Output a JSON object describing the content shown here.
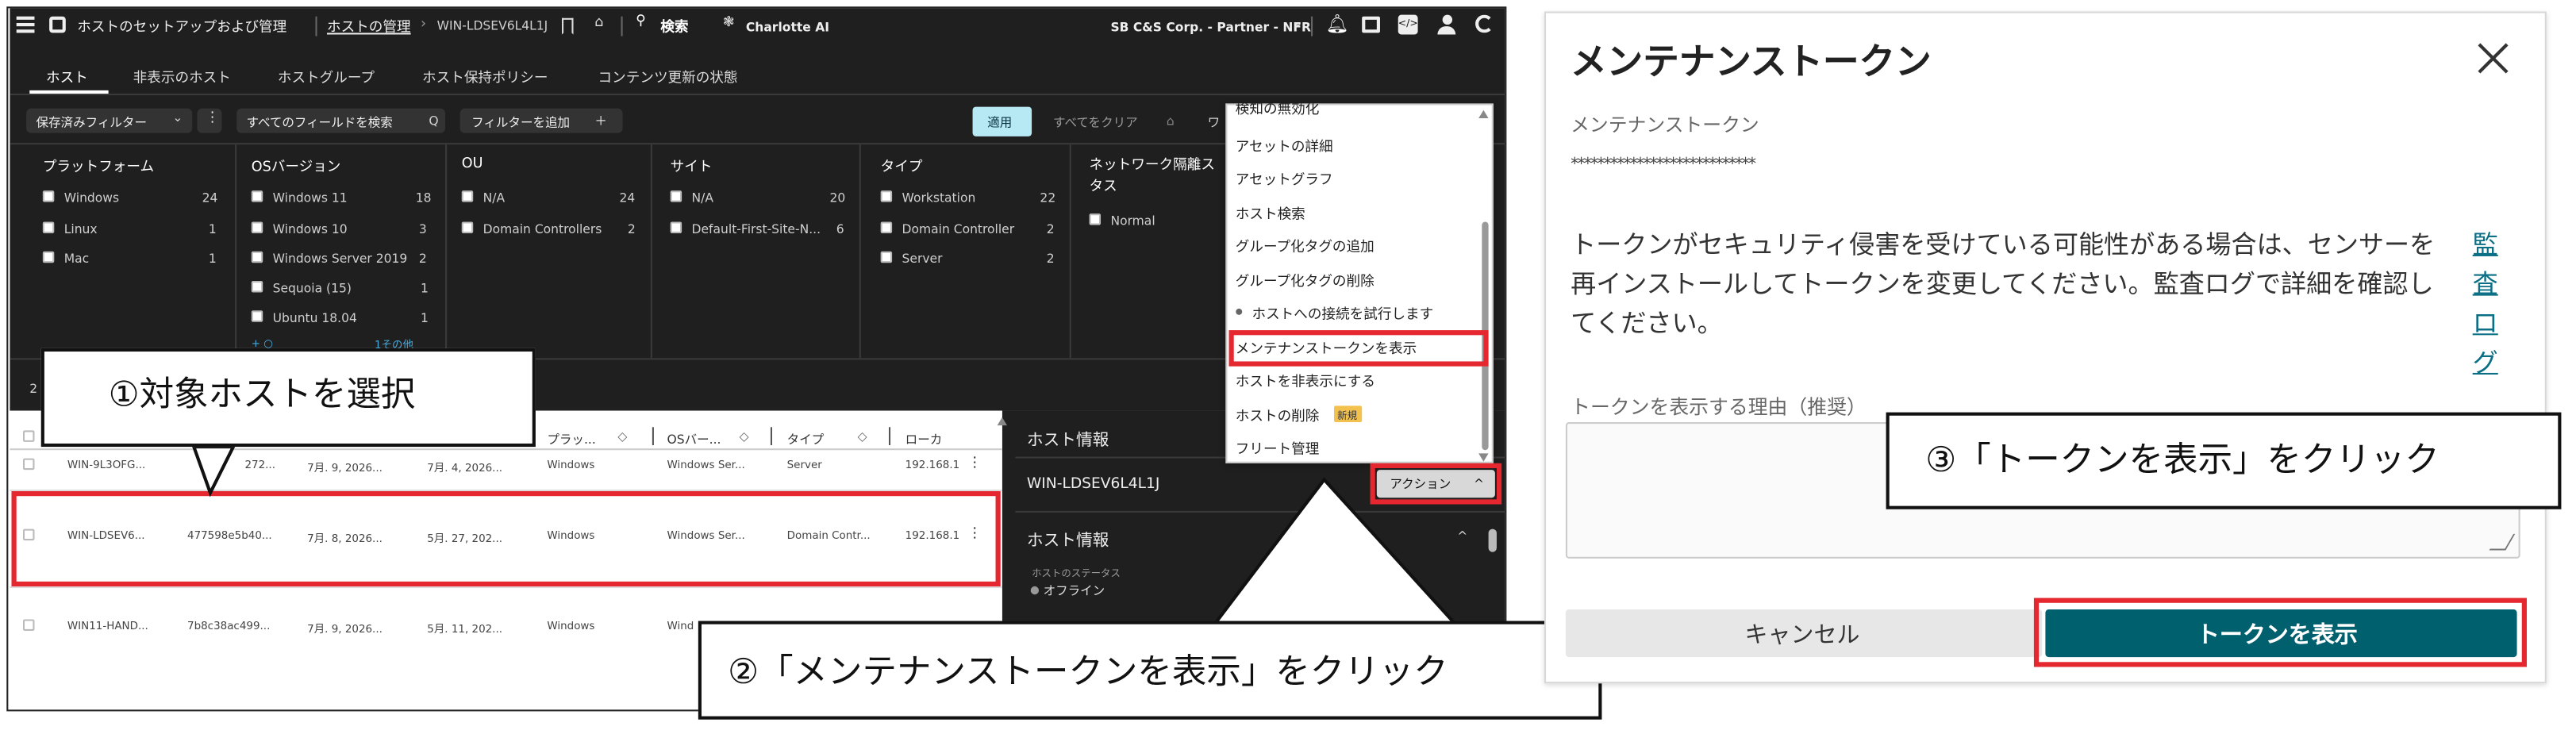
{
  "topbar": {
    "title": "ホストのセットアップおよび管理",
    "breadcrumb_link": "ホストの管理",
    "breadcrumb_sep": "›",
    "host": "WIN-LDSEV6L4L1J",
    "search": "検索",
    "charlotte": "Charlotte AI",
    "company": "SB C&S Corp. - Partner - NFR",
    "company_caret": "⌄"
  },
  "tabs": [
    "ホスト",
    "非表示のホスト",
    "ホストグループ",
    "ホスト保持ポリシー",
    "コンテンツ更新の状態"
  ],
  "filterbar": {
    "saved": "保存済みフィルター",
    "saved_caret": "⌄",
    "more": "⋮",
    "search_fields": "すべてのフィールドを検索",
    "search_icon": "Q",
    "add_filter": "フィルターを追加",
    "plus": "＋",
    "apply": "適用",
    "clear_all": "すべてをクリア",
    "trailing": "ワ"
  },
  "facets": [
    {
      "title": "プラットフォーム",
      "items": [
        {
          "label": "Windows",
          "count": "24"
        },
        {
          "label": "Linux",
          "count": "1"
        },
        {
          "label": "Mac",
          "count": "1"
        }
      ]
    },
    {
      "title": "OSバージョン",
      "items": [
        {
          "label": "Windows 11",
          "count": "18"
        },
        {
          "label": "Windows 10",
          "count": "3"
        },
        {
          "label": "Windows Server 2019",
          "count": "2"
        },
        {
          "label": "Sequoia (15)",
          "count": "1"
        },
        {
          "label": "Ubuntu 18.04",
          "count": "1"
        }
      ],
      "more": "1その他",
      "more_prefix": "+ ○"
    },
    {
      "title": "OU",
      "items": [
        {
          "label": "N/A",
          "count": "24"
        },
        {
          "label": "Domain Controllers",
          "count": "2"
        }
      ]
    },
    {
      "title": "サイト",
      "items": [
        {
          "label": "N/A",
          "count": "20"
        },
        {
          "label": "Default-First-Site-N...",
          "count": "6"
        }
      ]
    },
    {
      "title": "タイプ",
      "items": [
        {
          "label": "Workstation",
          "count": "22"
        },
        {
          "label": "Domain Controller",
          "count": "2"
        },
        {
          "label": "Server",
          "count": "2"
        }
      ]
    },
    {
      "title": "ネットワーク隔離ス タス",
      "items": [
        {
          "label": "Normal",
          "count": ""
        }
      ]
    }
  ],
  "results_count": "2",
  "table": {
    "headers": [
      "プラッ...",
      "OSバー...",
      "タイプ",
      "ローカ"
    ],
    "rows": [
      {
        "name": "WIN-9L3OFG...",
        "id": "272...",
        "first": "7月. 9, 2026...",
        "last": "7月. 4, 2026...",
        "platform": "Windows",
        "os": "Windows Ser...",
        "type": "Server",
        "ip": "192.168.1"
      },
      {
        "name": "WIN-LDSEV6...",
        "id": "477598e5b40...",
        "first": "7月. 8, 2026...",
        "last": "5月. 27, 202...",
        "platform": "Windows",
        "os": "Windows Ser...",
        "type": "Domain Contr...",
        "ip": "192.168.1"
      },
      {
        "name": "WIN11-HAND...",
        "id": "7b8c38ac499...",
        "first": "7月. 9, 2026...",
        "last": "5月. 11, 202...",
        "platform": "Windows",
        "os": "Wind",
        "type": "",
        "ip": ""
      }
    ],
    "kebab": "⋮"
  },
  "panel": {
    "header": "ホスト情報",
    "host": "WIN-LDSEV6L4L1J",
    "action": "アクション",
    "action_caret": "^",
    "section": "ホスト情報",
    "section_caret": "^",
    "status_label": "ホストのステータス",
    "status_dot": "●",
    "status": "オフライン"
  },
  "menu": {
    "items": [
      "検知の無効化",
      "アセットの詳細",
      "アセットグラフ",
      "ホスト検索",
      "グループ化タグの追加",
      "グループ化タグの削除",
      "ホストへの接続を試行します",
      "メンテナンストークンを表示",
      "ホストを非表示にする",
      "ホストの削除",
      "フリート管理"
    ],
    "new_badge": "新規",
    "bullet": "●"
  },
  "callouts": {
    "c1": "①対象ホストを選択",
    "c2": "②「メンテナンストークンを表示」をクリック",
    "c3": "③「トークンを表示」をクリック"
  },
  "dialog": {
    "title": "メンテナンストークン",
    "label": "メンテナンストークン",
    "masked": "****************************",
    "message": "トークンがセキュリティ侵害を受けている可能性がある場合は、センサーを再インストールしてトークンを変更してください。監査ログで詳細を確認してください。",
    "link": "監査ログ",
    "reason_label": "トークンを表示する理由（推奨）",
    "cancel": "キャンセル",
    "show": "トークンを表示"
  },
  "colors": {
    "primary": "#00606e",
    "highlight": "#e5272f",
    "dark_bg": "#1f1f1f",
    "apply_bg": "#b7e9f5",
    "new_badge": "#f2c14e"
  }
}
